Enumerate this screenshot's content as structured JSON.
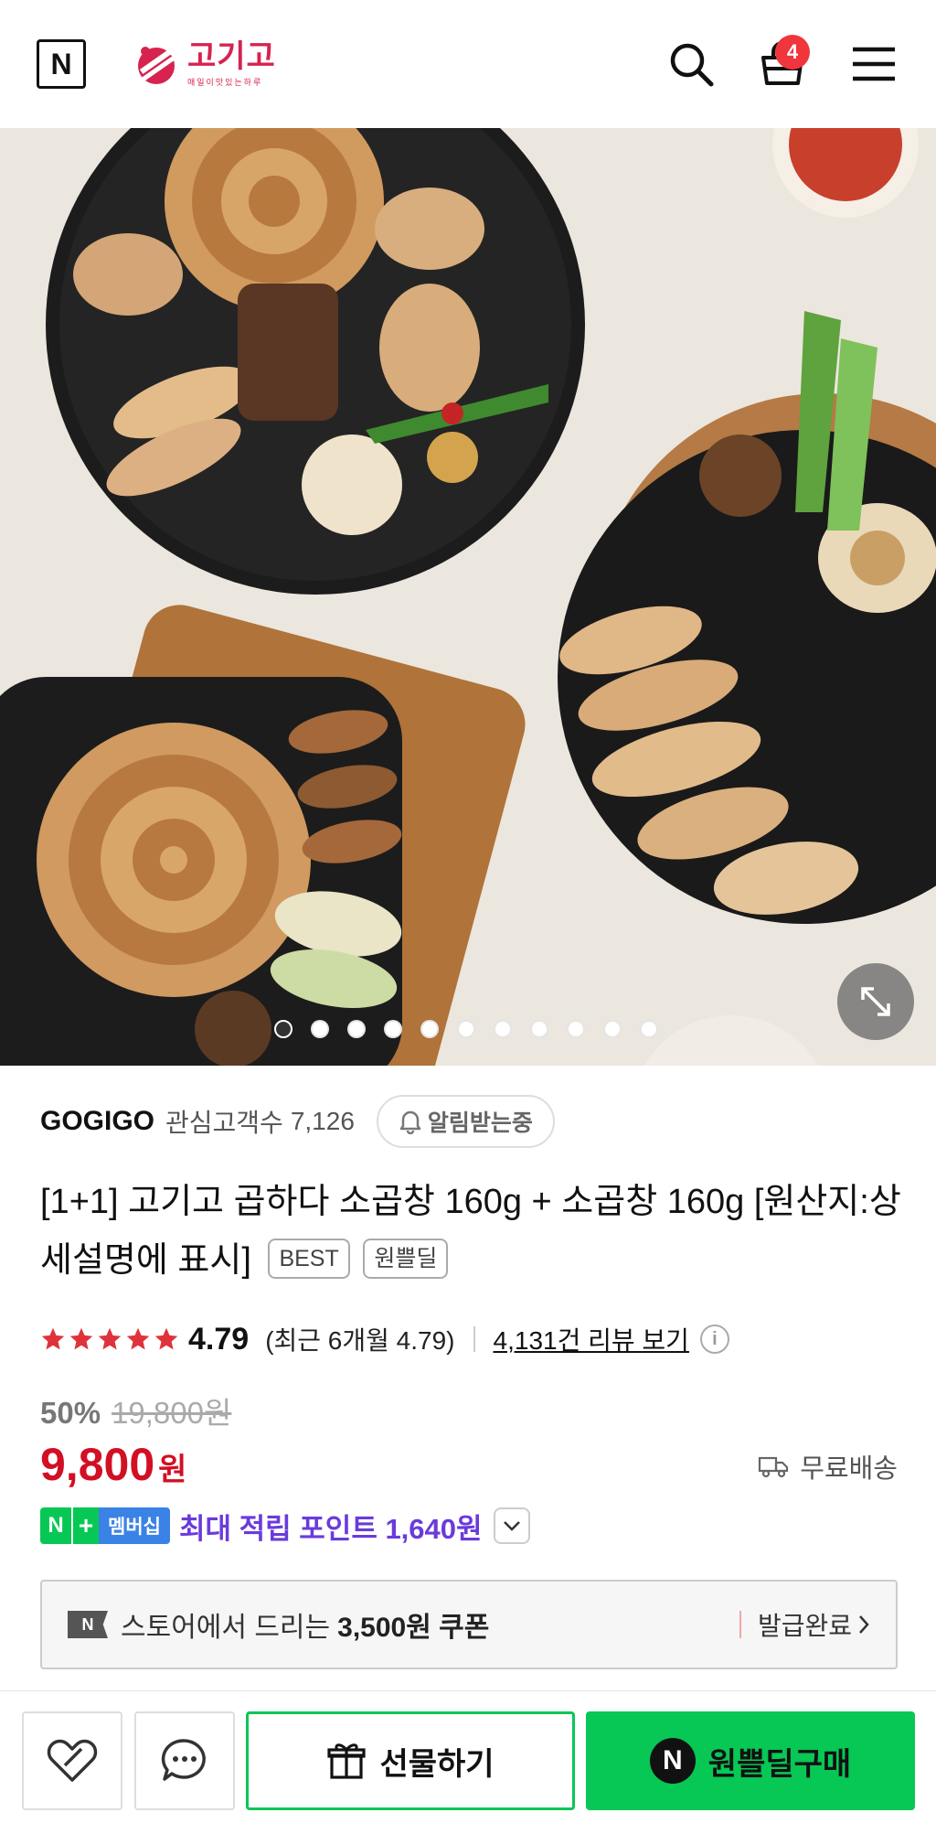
{
  "header": {
    "naver_logo": "N",
    "brand_name": "고기고",
    "brand_sub": "매일이맛있는하루",
    "cart_count": "4",
    "icons": [
      "naver-n-icon",
      "search-icon",
      "cart-icon",
      "menu-icon"
    ]
  },
  "gallery": {
    "slide_count": 11,
    "active_index": 0,
    "expand_icon": "expand-icon"
  },
  "seller": {
    "name": "GOGIGO",
    "fans_label": "관심고객수",
    "fans_count": "7,126",
    "alarm_label": "알림받는중"
  },
  "product": {
    "title": "[1+1] 고기고 곱하다 소곱창 160g + 소곱창 160g [원산지:상세설명에 표시]",
    "tags": [
      "BEST",
      "원쁠딜"
    ]
  },
  "rating": {
    "value": "4.79",
    "stars": 5,
    "recent": "(최근 6개월 4.79)",
    "review_link": "4,131건 리뷰 보기",
    "info_icon": "i"
  },
  "price": {
    "discount_rate": "50%",
    "original": "19,800원",
    "current": "9,800",
    "currency": "원",
    "shipping": "무료배송"
  },
  "points": {
    "badge_n": "N",
    "badge_plus": "+",
    "badge_member": "멤버십",
    "text": "최대 적립 포인트 1,640원"
  },
  "coupon": {
    "badge": "N",
    "text": "스토어에서 드리는",
    "amount": "3,500원 쿠폰",
    "status": "발급완료"
  },
  "bottom_bar": {
    "gift_label": "선물하기",
    "buy_label": "원쁠딜구매",
    "buy_badge": "N"
  },
  "colors": {
    "brand": "#d6234f",
    "price_red": "#d20f23",
    "naver_green": "#07c755",
    "points_purple": "#6a3bdb",
    "star_red": "#e0323a"
  }
}
